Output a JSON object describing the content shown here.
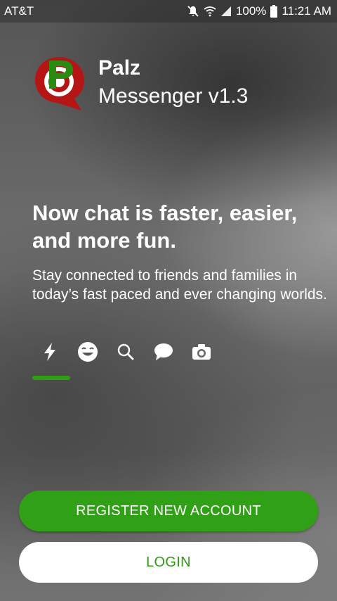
{
  "status_bar": {
    "carrier": "AT&T",
    "battery": "100%",
    "time": "11:21 AM",
    "icons": [
      "mute-icon",
      "wifi-icon",
      "signal-icon",
      "battery-icon"
    ]
  },
  "app": {
    "name": "Palz",
    "subtitle": "Messenger v1.3",
    "logo_letter": "P"
  },
  "intro": {
    "headline": "Now chat is faster, easier, and more fun.",
    "description": "Stay connected to friends and families in today’s fast paced and ever changing worlds."
  },
  "features": {
    "icons": [
      "lightning-icon",
      "smiley-icon",
      "search-icon",
      "chat-bubble-icon",
      "camera-icon"
    ],
    "active_index": 0
  },
  "actions": {
    "register_label": "REGISTER NEW ACCOUNT",
    "login_label": "LOGIN"
  },
  "colors": {
    "accent": "#30a016",
    "logo_red": "#b51515",
    "logo_green": "#2a8a12"
  }
}
